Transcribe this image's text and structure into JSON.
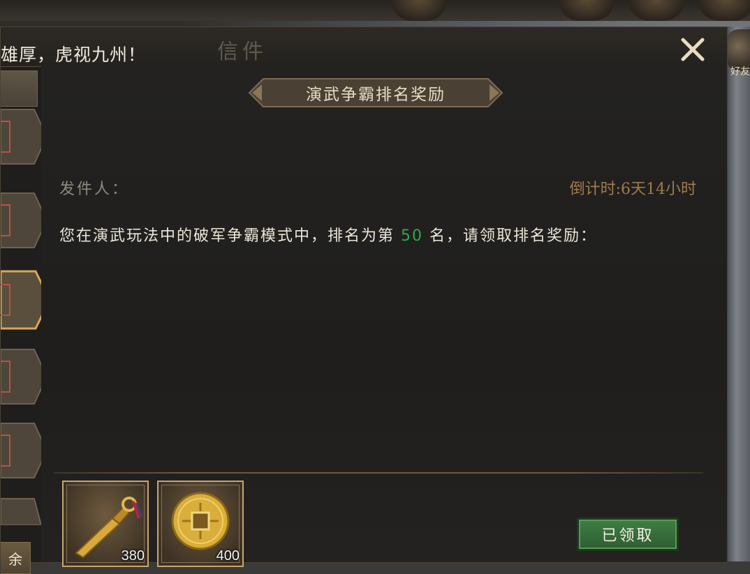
{
  "marquee": {
    "text": "雄厚，虎视九州！"
  },
  "window": {
    "title": "信件"
  },
  "edge": {
    "text": "好友"
  },
  "mail": {
    "subject": "演武争霸排名奖励",
    "sender_label": "发件人：",
    "countdown": "倒计时:6天14小时",
    "body_before": "您在演武玩法中的破军争霸模式中，排名为第 ",
    "rank": "50",
    "body_after": " 名，请领取排名奖励：",
    "claim_button": "已领取",
    "rewards": [
      {
        "icon": "gold-dagger-icon",
        "quantity": "380"
      },
      {
        "icon": "gold-coin-icon",
        "quantity": "400"
      }
    ]
  },
  "sidebar": {
    "bottom_button": "余"
  },
  "colors": {
    "rank_highlight": "#2fa84f",
    "countdown": "#a07b4d",
    "claim_button": "#3f7d43",
    "gold_border": "#c9a66b"
  }
}
